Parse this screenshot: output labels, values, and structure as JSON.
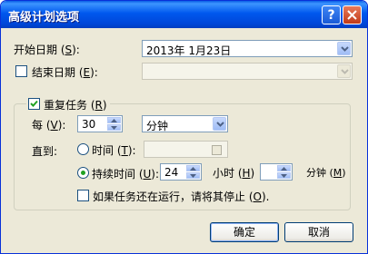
{
  "window": {
    "title": "高级计划选项"
  },
  "start_date": {
    "label_prefix": "开始日期 (",
    "label_mnemonic": "S",
    "label_suffix": "):",
    "value": "2013年  1月23日"
  },
  "end_date": {
    "checked": false,
    "label_prefix": "结束日期 (",
    "label_mnemonic": "E",
    "label_suffix": "):",
    "value": ""
  },
  "repeat": {
    "checked": true,
    "label_prefix": "重复任务 (",
    "label_mnemonic": "R",
    "label_suffix": ")",
    "every_label_prefix": "每 (",
    "every_mnemonic": "V",
    "every_label_suffix": "):",
    "every_value": "30",
    "unit_value": "分钟",
    "until_label": "直到:",
    "time_option_prefix": "时间 (",
    "time_option_mnemonic": "T",
    "time_option_suffix": "):",
    "duration_option_prefix": "持续时间 (",
    "duration_option_mnemonic": "U",
    "duration_option_suffix": "):",
    "duration_hours": "24",
    "hours_label_prefix": "小时 (",
    "hours_mnemonic": "H",
    "hours_label_suffix": ")",
    "duration_minutes": "",
    "minutes_label_prefix": "分钟 (",
    "minutes_mnemonic": "M",
    "minutes_label_suffix": ")",
    "stop_if_running_prefix": "如果任务还在运行，请将其停止 (",
    "stop_if_running_mnemonic": "O",
    "stop_if_running_suffix": ")."
  },
  "buttons": {
    "ok": "确定",
    "cancel": "取消"
  },
  "colors": {
    "titlebar": "#0058ee",
    "dialog_bg": "#ece9d8",
    "radio_dot": "#21a121"
  }
}
